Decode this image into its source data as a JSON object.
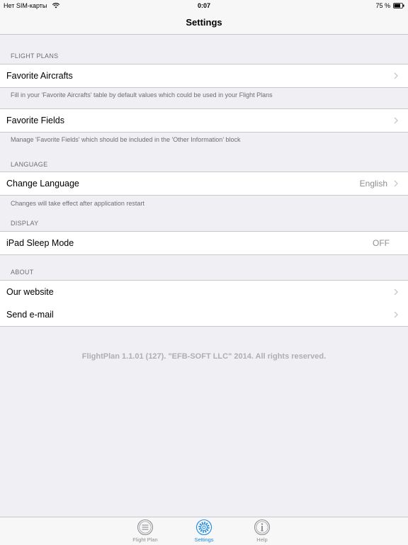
{
  "status_bar": {
    "carrier": "Нет SIM-карты",
    "time": "0:07",
    "battery": "75 %"
  },
  "nav": {
    "title": "Settings"
  },
  "sections": {
    "flight_plans": {
      "header": "FLIGHT PLANS",
      "favorite_aircrafts": {
        "label": "Favorite Aircrafts",
        "note": "Fill in your 'Favorite Aircrafts' table by default values which could be used in your Flight Plans"
      },
      "favorite_fields": {
        "label": "Favorite Fields",
        "note": "Manage 'Favorite Fields' which should be included in the 'Other Information' block"
      }
    },
    "language": {
      "header": "LANGUAGE",
      "label": "Change Language",
      "value": "English",
      "note": "Changes will take effect after application restart"
    },
    "display": {
      "header": "DISPLAY",
      "label": "iPad Sleep Mode",
      "value": "OFF"
    },
    "about": {
      "header": "ABOUT",
      "website": "Our website",
      "email": "Send e-mail"
    }
  },
  "copyright": "FlightPlan 1.1.01 (127). \"EFB-SOFT LLC\" 2014. All rights reserved.",
  "tab_bar": {
    "tabs": [
      {
        "label": "Flight Plan",
        "icon": "list-icon"
      },
      {
        "label": "Settings",
        "icon": "gear-icon",
        "active": true
      },
      {
        "label": "Help",
        "icon": "info-icon"
      }
    ]
  },
  "colors": {
    "accent": "#1a8ae5",
    "background": "#efeff4",
    "secondary_text": "#6d6d72"
  }
}
